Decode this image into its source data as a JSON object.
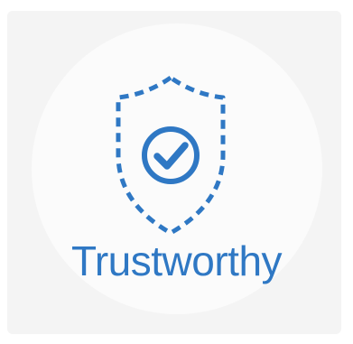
{
  "badge": {
    "label": "Trustworthy",
    "icon": "shield-check-icon",
    "accent_color": "#2f78c4",
    "tile_color": "#f4f4f4",
    "circle_color": "#fbfbfb"
  }
}
